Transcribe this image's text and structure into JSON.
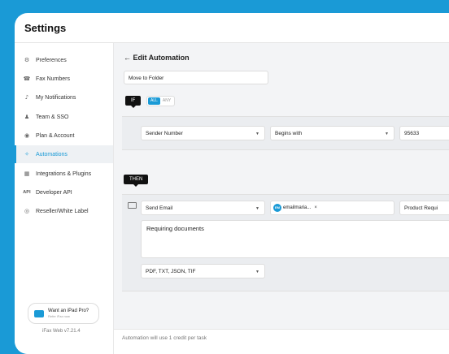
{
  "window": {
    "title": "Settings"
  },
  "sidebar": {
    "items": [
      {
        "label": "Preferences",
        "icon": "gear-icon",
        "glyph": "⚙"
      },
      {
        "label": "Fax Numbers",
        "icon": "fax-icon",
        "glyph": "☎"
      },
      {
        "label": "My Notifications",
        "icon": "bell-icon",
        "glyph": "♪"
      },
      {
        "label": "Team & SSO",
        "icon": "team-icon",
        "glyph": "♟"
      },
      {
        "label": "Plan & Account",
        "icon": "account-icon",
        "glyph": "◉"
      },
      {
        "label": "Automations",
        "icon": "automation-icon",
        "glyph": "✧",
        "active": true
      },
      {
        "label": "Integrations & Plugins",
        "icon": "grid-icon",
        "glyph": "▦"
      },
      {
        "label": "Developer API",
        "icon": "api-icon",
        "glyph": "API"
      },
      {
        "label": "Reseller/White Label",
        "icon": "label-icon",
        "glyph": "◎"
      }
    ],
    "promo": {
      "title": "Want an iPad Pro?",
      "subtitle": "Refer iFax now"
    },
    "version": "iFax Web v7.21.4"
  },
  "editor": {
    "back_label": "← Edit Automation",
    "name_value": "Move to Folder",
    "if_label": "IF",
    "toggle": {
      "all": "ALL",
      "any": "ANY",
      "selected": "ALL"
    },
    "condition": {
      "field": "Sender Number",
      "operator": "Begins with",
      "value": "95633"
    },
    "then_label": "THEN",
    "action": {
      "type": "Send Email",
      "recipient_initials": "EM",
      "recipient": "emailmaria...",
      "remove_glyph": "×",
      "subject": "Product Requi",
      "body": "Requiring documents",
      "formats": "PDF, TXT, JSON, TIF"
    },
    "footer_note": "Automation will use 1 credit per task"
  },
  "colors": {
    "accent": "#1a9ad6",
    "background": "#f3f4f6"
  }
}
